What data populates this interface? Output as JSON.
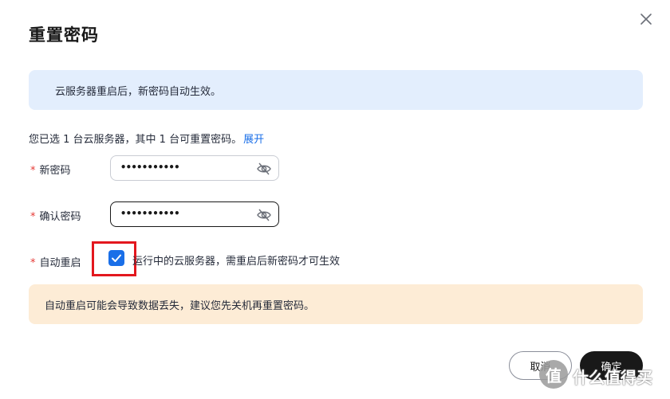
{
  "dialog": {
    "title": "重置密码"
  },
  "info_banner": {
    "text": "云服务器重启后，新密码自动生效。"
  },
  "selection": {
    "text": "您已选 1 台云服务器，其中 1 台可重置密码。",
    "expand_link": "展开"
  },
  "fields": {
    "required_mark": "*",
    "new_password": {
      "label": "新密码",
      "masked_value": "•••••••••••"
    },
    "confirm_password": {
      "label": "确认密码",
      "masked_value": "•••••••••••"
    },
    "auto_restart": {
      "label": "自动重启",
      "checked": true,
      "checkbox_text": "运行中的云服务器，需重启后新密码才可生效"
    }
  },
  "warning_banner": {
    "text": "自动重启可能会导致数据丢失，建议您先关机再重置密码。"
  },
  "buttons": {
    "cancel": "取消",
    "confirm": "确定"
  },
  "watermark": {
    "logo_char": "值",
    "text": "什么值得买"
  },
  "colors": {
    "accent": "#1a6fe8",
    "info_bg": "#e3eefd",
    "warning_bg": "#fdecd6",
    "required": "#e53935",
    "highlight_box": "#e3171e",
    "primary_button": "#191919"
  },
  "icons": {
    "close": "close-icon",
    "password_visibility": "eye-off-icon",
    "checkbox": "checkmark-icon"
  }
}
